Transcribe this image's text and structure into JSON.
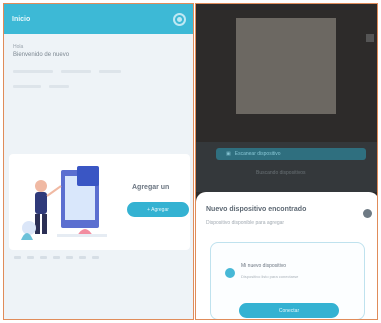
{
  "left_screen": {
    "header": {
      "title": "Inicio"
    },
    "field": {
      "label": "Hola",
      "value": "Bienvenido de nuevo"
    },
    "card": {
      "title": "Agregar un",
      "button_label": "+ Agregar"
    }
  },
  "right_screen": {
    "scan": {
      "button_label": "Escanear dispositivo",
      "subtitle": "Buscando dispositivos"
    },
    "sheet": {
      "title": "Nuevo dispositivo encontrado",
      "subtitle": "Dispositivo disponible para agregar",
      "device_name": "Mi nuevo dispositivo",
      "device_desc": "Dispositivo listo para conectarse",
      "button_label": "Conectar"
    }
  },
  "colors": {
    "accent": "#3db9d6",
    "frame": "#e08c5a",
    "camera_bg": "#2d2b2a"
  }
}
